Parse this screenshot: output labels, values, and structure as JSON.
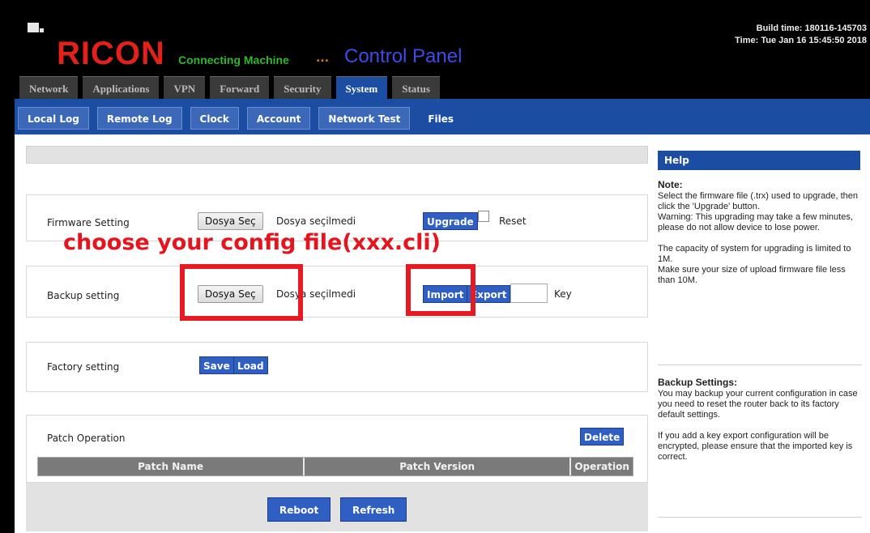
{
  "header": {
    "brand": "RICON",
    "tagline": "Connecting Machine",
    "dots": "...",
    "title": "Control Panel",
    "build_time": "Build time: 180116-145703",
    "time": "Time: Tue Jan 16 15:45:50 2018"
  },
  "main_tabs": [
    "Network",
    "Applications",
    "VPN",
    "Forward",
    "Security",
    "System",
    "Status"
  ],
  "active_main_tab": "System",
  "sub_tabs": [
    "Local Log",
    "Remote Log",
    "Clock",
    "Account",
    "Network Test",
    "Files"
  ],
  "active_sub_tab": "Files",
  "firmware": {
    "label": "Firmware Setting",
    "file_button": "Dosya Seç",
    "file_status": "Dosya seçilmedi",
    "upgrade": "Upgrade",
    "reset": "Reset"
  },
  "annotation": "choose your config file(xxx.cli)",
  "backup": {
    "label": "Backup setting",
    "file_button": "Dosya Seç",
    "file_status": "Dosya seçilmedi",
    "import": "Import",
    "export": "Export",
    "key": "Key"
  },
  "factory": {
    "label": "Factory setting",
    "save": "Save",
    "load": "Load"
  },
  "patch": {
    "label": "Patch Operation",
    "delete": "Delete",
    "columns": [
      "Patch Name",
      "Patch Version",
      "Operation"
    ]
  },
  "footer": {
    "reboot": "Reboot",
    "refresh": "Refresh"
  },
  "help": {
    "title": "Help",
    "note_heading": "Note:",
    "note_1": "Select the firmware file (.trx) used to upgrade, then click the 'Upgrade' button.",
    "note_2": "Warning: This upgrading may take a few minutes, please do not allow device to lose power.",
    "note_3": "The capacity of system for upgrading is limited to 1M.",
    "note_4": "Make sure your size of upload firmware file less than 10M.",
    "backup_heading": "Backup Settings:",
    "backup_1": "You may backup your current configuration in case you need to reset the router back to its factory default settings.",
    "backup_2": "If you add a key export configuration will be encrypted, please ensure that the imported key is correct."
  },
  "colors": {
    "brand_red": "#e32119",
    "nav_blue": "#1b4ea3",
    "annotation_red": "#e5141d"
  }
}
